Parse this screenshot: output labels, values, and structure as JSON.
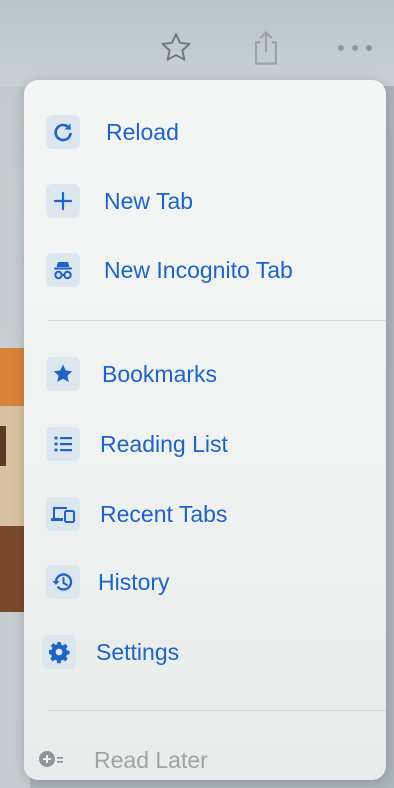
{
  "toolbar": {
    "bookmark_icon": "star-outline-icon",
    "share_icon": "share-icon",
    "more_icon": "more-dots-icon"
  },
  "menu": {
    "items": [
      {
        "label": "Reload",
        "icon": "reload-icon"
      },
      {
        "label": "New Tab",
        "icon": "plus-icon"
      },
      {
        "label": "New Incognito Tab",
        "icon": "incognito-icon"
      },
      {
        "label": "Bookmarks",
        "icon": "star-icon"
      },
      {
        "label": "Reading List",
        "icon": "list-icon"
      },
      {
        "label": "Recent Tabs",
        "icon": "devices-icon"
      },
      {
        "label": "History",
        "icon": "history-icon"
      },
      {
        "label": "Settings",
        "icon": "gear-icon"
      },
      {
        "label": "Read Later",
        "icon": "add-reading-list-icon"
      }
    ]
  },
  "colors": {
    "accent": "#1e63c8",
    "disabled": "#9ea3a6"
  }
}
